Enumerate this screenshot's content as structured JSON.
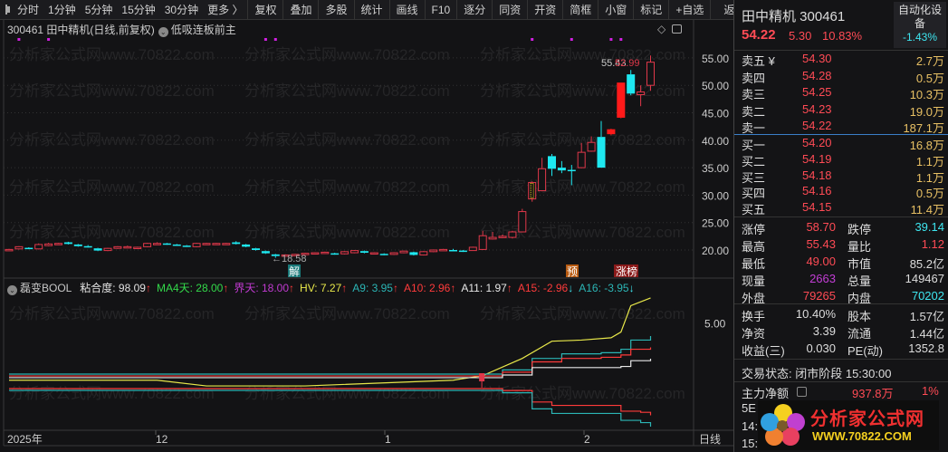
{
  "toolbar": {
    "periods": [
      "分时",
      "1分钟",
      "5分钟",
      "15分钟",
      "30分钟",
      "更多 〉"
    ],
    "buttons": [
      "复权",
      "叠加",
      "多股",
      "统计",
      "画线",
      "F10",
      "逐分",
      "同资",
      "开资",
      "简框",
      "小窗",
      "标记",
      "+自选"
    ],
    "back": "返回"
  },
  "info": {
    "title": "300461 田中精机(日线,前复权)",
    "strategy": "低吸连板前主"
  },
  "watermark": "分析家公式网www.70822.com",
  "price_axis": [
    "55.00",
    "50.00",
    "45.00",
    "40.00",
    "35.00",
    "30.00",
    "25.00",
    "20.00"
  ],
  "price_axis_values": [
    55,
    50,
    45,
    40,
    35,
    30,
    25,
    20
  ],
  "annotations": {
    "low_label": "←18.58",
    "high_label": "55.43",
    "close_label": "52.99",
    "tag_jie": "解",
    "tag_yu": "预",
    "tag_zhangbang": "涨榜"
  },
  "candles": [
    [
      20.0,
      20.2,
      19.9,
      20.1
    ],
    [
      20.2,
      20.7,
      20.1,
      20.6
    ],
    [
      20.4,
      20.5,
      20.2,
      20.3
    ],
    [
      20.2,
      21.2,
      20.1,
      21.0
    ],
    [
      20.8,
      21.3,
      20.7,
      21.1
    ],
    [
      21.1,
      21.3,
      21.0,
      21.2
    ],
    [
      21.4,
      21.5,
      21.0,
      21.1
    ],
    [
      21.0,
      21.1,
      20.6,
      20.7
    ],
    [
      20.7,
      20.9,
      20.5,
      20.6
    ],
    [
      20.3,
      20.4,
      19.8,
      19.9
    ],
    [
      19.9,
      20.4,
      19.8,
      20.3
    ],
    [
      20.3,
      20.7,
      20.2,
      20.6
    ],
    [
      20.6,
      20.8,
      20.5,
      20.6
    ],
    [
      20.3,
      20.6,
      20.2,
      20.5
    ],
    [
      20.6,
      21.3,
      20.5,
      21.2
    ],
    [
      21.2,
      21.4,
      21.1,
      21.2
    ],
    [
      21.2,
      21.3,
      21.1,
      21.1
    ],
    [
      21.0,
      21.1,
      20.8,
      20.9
    ],
    [
      20.8,
      20.9,
      20.6,
      20.7
    ],
    [
      20.6,
      21.3,
      20.5,
      21.2
    ],
    [
      21.2,
      21.3,
      21.1,
      21.2
    ],
    [
      21.2,
      21.3,
      21.1,
      21.2
    ],
    [
      21.2,
      21.3,
      21.1,
      21.2
    ],
    [
      21.4,
      21.6,
      21.0,
      21.1
    ],
    [
      21.0,
      21.1,
      20.5,
      20.6
    ],
    [
      20.3,
      20.4,
      19.9,
      20.0
    ],
    [
      19.8,
      19.9,
      19.3,
      19.4
    ],
    [
      19.2,
      19.3,
      18.58,
      18.9
    ],
    [
      18.9,
      19.2,
      18.8,
      19.1
    ],
    [
      19.1,
      19.3,
      19.0,
      19.2
    ],
    [
      19.2,
      19.5,
      19.1,
      19.4
    ],
    [
      19.5,
      19.6,
      19.4,
      19.5
    ],
    [
      19.6,
      19.7,
      19.5,
      19.6
    ],
    [
      19.4,
      19.5,
      19.2,
      19.3
    ],
    [
      19.3,
      19.8,
      19.2,
      19.7
    ],
    [
      19.5,
      20.0,
      19.4,
      19.9
    ],
    [
      19.8,
      19.9,
      19.4,
      19.5
    ],
    [
      19.5,
      19.6,
      19.4,
      19.5
    ],
    [
      19.3,
      19.4,
      19.1,
      19.2
    ],
    [
      19.2,
      19.6,
      19.1,
      19.5
    ],
    [
      19.5,
      19.9,
      19.4,
      19.8
    ],
    [
      19.6,
      19.7,
      19.0,
      19.1
    ],
    [
      19.1,
      19.8,
      19.0,
      19.7
    ],
    [
      19.7,
      20.1,
      19.6,
      20.0
    ],
    [
      20.0,
      20.2,
      19.9,
      20.1
    ],
    [
      20.0,
      20.2,
      19.8,
      19.9
    ],
    [
      19.9,
      20.0,
      19.7,
      19.8
    ],
    [
      19.9,
      20.6,
      19.9,
      20.5
    ],
    [
      20.1,
      23.5,
      20.0,
      22.6
    ],
    [
      22.0,
      23.3,
      21.9,
      22.3
    ],
    [
      22.5,
      22.8,
      22.2,
      22.5
    ],
    [
      22.3,
      23.5,
      22.1,
      23.3
    ],
    [
      23.3,
      27.5,
      23.2,
      27.0
    ],
    [
      29.3,
      32.5,
      28.8,
      32.3,
      2
    ],
    [
      30.8,
      36.8,
      30.7,
      34.8
    ],
    [
      37.1,
      37.5,
      33.5,
      34.8
    ],
    [
      35.0,
      36.2,
      34.0,
      34.5
    ],
    [
      34.6,
      35.5,
      31.8,
      34.5
    ],
    [
      35.0,
      39.5,
      34.9,
      37.8
    ],
    [
      38.0,
      40.7,
      37.9,
      39.6
    ],
    [
      40.6,
      43.5,
      35.0,
      35.0
    ],
    [
      41.1,
      42.1,
      40.9,
      42.0,
      1
    ],
    [
      44.1,
      50.5,
      44.0,
      50.5,
      1
    ],
    [
      52.0,
      52.8,
      48.2,
      48.5
    ],
    [
      48.3,
      50.0,
      46.2,
      48.8
    ],
    [
      50.0,
      55.43,
      49.0,
      54.22
    ]
  ],
  "signal_markers": [
    1,
    4,
    26,
    27,
    53,
    57,
    61,
    62
  ],
  "indicator": {
    "name": "磊变BOOL",
    "items": [
      {
        "label": "粘合度: 98.09",
        "color": "#e0e0e0",
        "arrow": "↑"
      },
      {
        "label": "MA4天: 28.00",
        "color": "#33d94a",
        "arrow": "↑"
      },
      {
        "label": "界天: 18.00",
        "color": "#c03ad0",
        "arrow": "↑"
      },
      {
        "label": "HV: 7.27",
        "color": "#e8e84a",
        "arrow": "↑"
      },
      {
        "label": "A9: 3.95",
        "color": "#2bb5b5",
        "arrow": "↑"
      },
      {
        "label": "A10: 2.96",
        "color": "#ff3b3b",
        "arrow": "↑"
      },
      {
        "label": "A11: 1.97",
        "color": "#e8e8e8",
        "arrow": "↑"
      },
      {
        "label": "A15: -2.96",
        "color": "#ff3b3b",
        "arrow": "↓"
      },
      {
        "label": "A16: -3.95",
        "color": "#2bb5b5",
        "arrow": "↓"
      }
    ],
    "axis_label": "5.00",
    "axis_value": 5,
    "series": [
      {
        "name": "HV",
        "color": "#e8e84a",
        "points": [
          [
            0,
            0.1
          ],
          [
            15,
            0.1
          ],
          [
            20,
            -0.4
          ],
          [
            30,
            -0.4
          ],
          [
            45,
            0.1
          ],
          [
            48,
            0.5
          ],
          [
            52,
            2.0
          ],
          [
            55,
            3.5
          ],
          [
            58,
            3.6
          ],
          [
            61,
            3.8
          ],
          [
            62,
            4.3
          ],
          [
            63,
            6.6
          ],
          [
            65,
            7.27
          ]
        ]
      },
      {
        "name": "A9",
        "color": "#2bb5b5",
        "points": [
          [
            0,
            0.63
          ],
          [
            47,
            0.63
          ],
          [
            50,
            1.0
          ],
          [
            53,
            2.0
          ],
          [
            56,
            2.4
          ],
          [
            60,
            2.5
          ],
          [
            62,
            2.8
          ],
          [
            63,
            3.6
          ],
          [
            65,
            3.95
          ]
        ]
      },
      {
        "name": "A10",
        "color": "#ff3b3b",
        "points": [
          [
            0,
            0.47
          ],
          [
            47,
            0.47
          ],
          [
            50,
            0.8
          ],
          [
            53,
            1.7
          ],
          [
            56,
            2.0
          ],
          [
            60,
            2.1
          ],
          [
            62,
            2.3
          ],
          [
            63,
            2.8
          ],
          [
            65,
            2.96
          ]
        ]
      },
      {
        "name": "A11",
        "color": "#e8e8e8",
        "points": [
          [
            0,
            0.32
          ],
          [
            47,
            0.32
          ],
          [
            50,
            0.55
          ],
          [
            53,
            1.2
          ],
          [
            60,
            1.2
          ],
          [
            62,
            1.3
          ],
          [
            63,
            1.8
          ],
          [
            65,
            1.97
          ]
        ]
      },
      {
        "name": "A15",
        "color": "#ff3b3b",
        "points": [
          [
            0,
            -0.63
          ],
          [
            48,
            -0.63
          ],
          [
            50,
            -0.8
          ],
          [
            53,
            -1.8
          ],
          [
            55,
            -2.1
          ],
          [
            61,
            -2.1
          ],
          [
            62,
            -2.6
          ],
          [
            64,
            -2.7
          ],
          [
            65,
            -2.96
          ]
        ]
      },
      {
        "name": "A16",
        "color": "#2bb5b5",
        "points": [
          [
            0,
            -0.79
          ],
          [
            48,
            -0.79
          ],
          [
            50,
            -1.0
          ],
          [
            53,
            -2.4
          ],
          [
            55,
            -2.8
          ],
          [
            61,
            -2.8
          ],
          [
            62,
            -3.4
          ],
          [
            64,
            -3.6
          ],
          [
            65,
            -3.95
          ]
        ]
      }
    ]
  },
  "time_axis": {
    "labels": [
      "2025年",
      "12",
      "1",
      "2"
    ],
    "period": "日线"
  },
  "quote": {
    "name": "田中精机 300461",
    "price": "54.22",
    "change": "5.30",
    "pct": "10.83%",
    "sector": "自动化设备",
    "sector_pct": "-1.43%"
  },
  "orderbook": {
    "asks": [
      [
        "卖五 ¥",
        "54.30",
        "2.7万"
      ],
      [
        "卖四",
        "54.28",
        "0.5万"
      ],
      [
        "卖三",
        "54.25",
        "10.3万"
      ],
      [
        "卖二",
        "54.23",
        "19.0万"
      ],
      [
        "卖一",
        "54.22",
        "187.1万"
      ]
    ],
    "bids": [
      [
        "买一",
        "54.20",
        "16.8万"
      ],
      [
        "买二",
        "54.19",
        "1.1万"
      ],
      [
        "买三",
        "54.18",
        "1.1万"
      ],
      [
        "买四",
        "54.16",
        "0.5万"
      ],
      [
        "买五",
        "54.15",
        "11.4万"
      ]
    ]
  },
  "stats": [
    [
      "涨停",
      "58.70",
      "red",
      "跌停",
      "39.14",
      "cyan"
    ],
    [
      "最高",
      "55.43",
      "red",
      "量比",
      "1.12",
      "red"
    ],
    [
      "最低",
      "49.00",
      "red",
      "市值",
      "85.2亿",
      "wht"
    ],
    [
      "现量",
      "2663",
      "mag",
      "总量",
      "149467",
      "wht"
    ],
    [
      "外盘",
      "79265",
      "red",
      "内盘",
      "70202",
      "cyan"
    ]
  ],
  "stats2": [
    [
      "换手",
      "10.40%",
      "股本",
      "1.57亿"
    ],
    [
      "净资",
      "3.39",
      "流通",
      "1.44亿"
    ],
    [
      "收益(三)",
      "0.030",
      "PE(动)",
      "1352.8"
    ]
  ],
  "trade_status": "交易状态: 闭市阶段 15:30:00",
  "main_flow": {
    "label": "主力净额",
    "value": "937.8万",
    "pct": "1%"
  },
  "partial_rows": [
    "5E",
    "14:",
    "15:"
  ],
  "logo": {
    "title": "分析家公式网",
    "url": "WWW.70822.COM"
  }
}
